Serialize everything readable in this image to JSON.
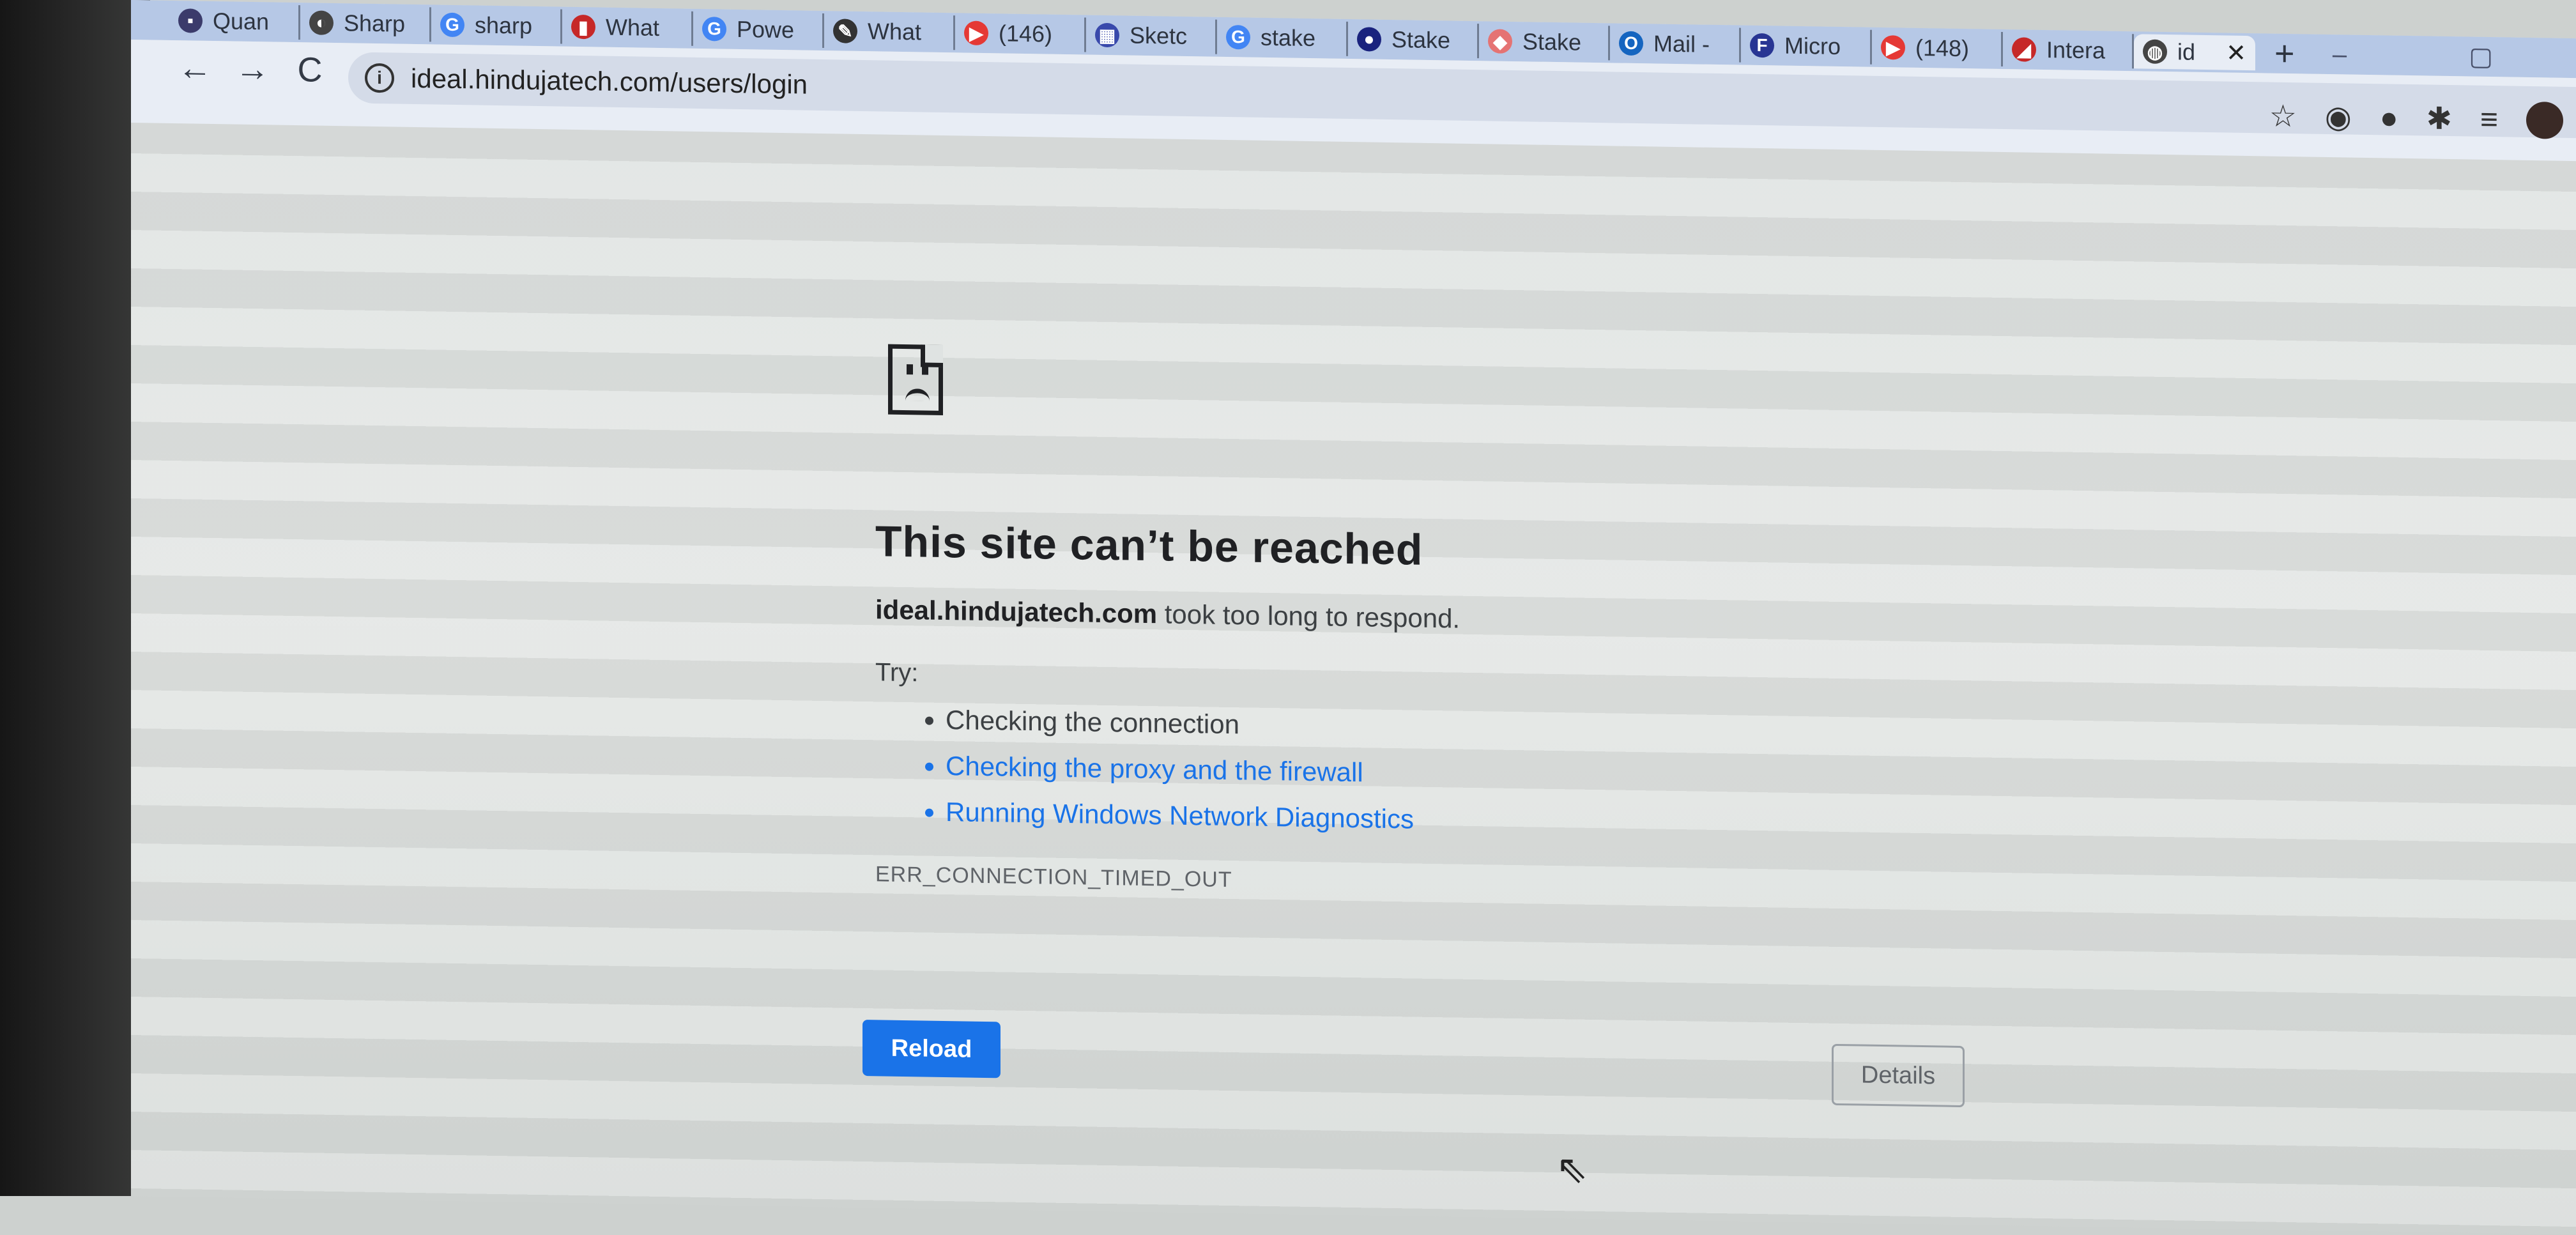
{
  "tabs": [
    {
      "label": "Quan",
      "favicon": "app-icon",
      "color": "#3b3b6b",
      "glyph": "▪"
    },
    {
      "label": "Sharp",
      "favicon": "sharp-icon",
      "color": "#444",
      "glyph": "◐"
    },
    {
      "label": "sharp",
      "favicon": "google-icon",
      "color": "#4285f4",
      "glyph": "G"
    },
    {
      "label": "What",
      "favicon": "chart-icon",
      "color": "#c62828",
      "glyph": "▮"
    },
    {
      "label": "Powe",
      "favicon": "google-icon",
      "color": "#4285f4",
      "glyph": "G"
    },
    {
      "label": "What",
      "favicon": "pin-icon",
      "color": "#333",
      "glyph": "✎"
    },
    {
      "label": "(146)",
      "favicon": "youtube-icon",
      "color": "#e53935",
      "glyph": "▶"
    },
    {
      "label": "Sketc",
      "favicon": "sketch-icon",
      "color": "#3949ab",
      "glyph": "▦"
    },
    {
      "label": "stake",
      "favicon": "google-icon",
      "color": "#4285f4",
      "glyph": "G"
    },
    {
      "label": "Stake",
      "favicon": "dots-icon",
      "color": "#1a237e",
      "glyph": "●"
    },
    {
      "label": "Stake",
      "favicon": "stake-icon",
      "color": "#e57373",
      "glyph": "◆"
    },
    {
      "label": "Mail -",
      "favicon": "outlook-icon",
      "color": "#1565c0",
      "glyph": "O"
    },
    {
      "label": "Micro",
      "favicon": "forms-icon",
      "color": "#283593",
      "glyph": "F"
    },
    {
      "label": "(148)",
      "favicon": "youtube-icon",
      "color": "#e53935",
      "glyph": "▶"
    },
    {
      "label": "Intera",
      "favicon": "flag-icon",
      "color": "#c62828",
      "glyph": "◢"
    }
  ],
  "active_tab": {
    "label": "id",
    "favicon": "globe-icon",
    "close": "✕"
  },
  "new_tab": "+",
  "window_controls": "– ▢",
  "toolbar": {
    "back": "←",
    "forward": "→",
    "reload": "C",
    "info": "i",
    "url": "ideal.hindujatech.com/users/login",
    "icons": [
      "☆",
      "◉",
      "●",
      "✱",
      "≡"
    ]
  },
  "error": {
    "title": "This site can’t be reached",
    "host": "ideal.hindujatech.com",
    "message": " took too long to respond.",
    "try_label": "Try:",
    "suggestions": [
      {
        "text": "Checking the connection",
        "link": false
      },
      {
        "text": "Checking the proxy and the firewall",
        "link": true
      },
      {
        "text": "Running Windows Network Diagnostics",
        "link": true
      }
    ],
    "code": "ERR_CONNECTION_TIMED_OUT",
    "reload_label": "Reload",
    "details_label": "Details"
  }
}
